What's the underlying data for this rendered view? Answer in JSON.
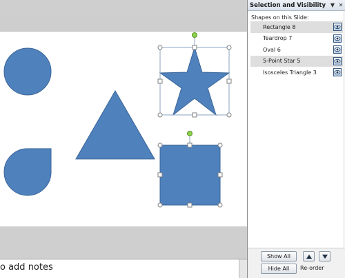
{
  "notes": {
    "placeholder_text": "o add notes"
  },
  "panel": {
    "title": "Selection and Visibility",
    "menu_icon": "▼",
    "close_icon": "✕",
    "section_label": "Shapes on this Slide:",
    "items": [
      {
        "label": "Rectangle 8",
        "selected": true,
        "visible": true
      },
      {
        "label": "Teardrop 7",
        "selected": false,
        "visible": true
      },
      {
        "label": "Oval 6",
        "selected": false,
        "visible": true
      },
      {
        "label": "5-Point Star 5",
        "selected": true,
        "visible": true
      },
      {
        "label": "Isosceles Triangle 3",
        "selected": false,
        "visible": true
      }
    ],
    "show_all_label": "Show All",
    "hide_all_label": "Hide All",
    "reorder_label": "Re-order"
  },
  "colors": {
    "shape_fill": "#4f81bd",
    "shape_stroke": "#3a6597",
    "handle_rotate": "#8bd34a",
    "selection_line": "#8aa3c0"
  }
}
